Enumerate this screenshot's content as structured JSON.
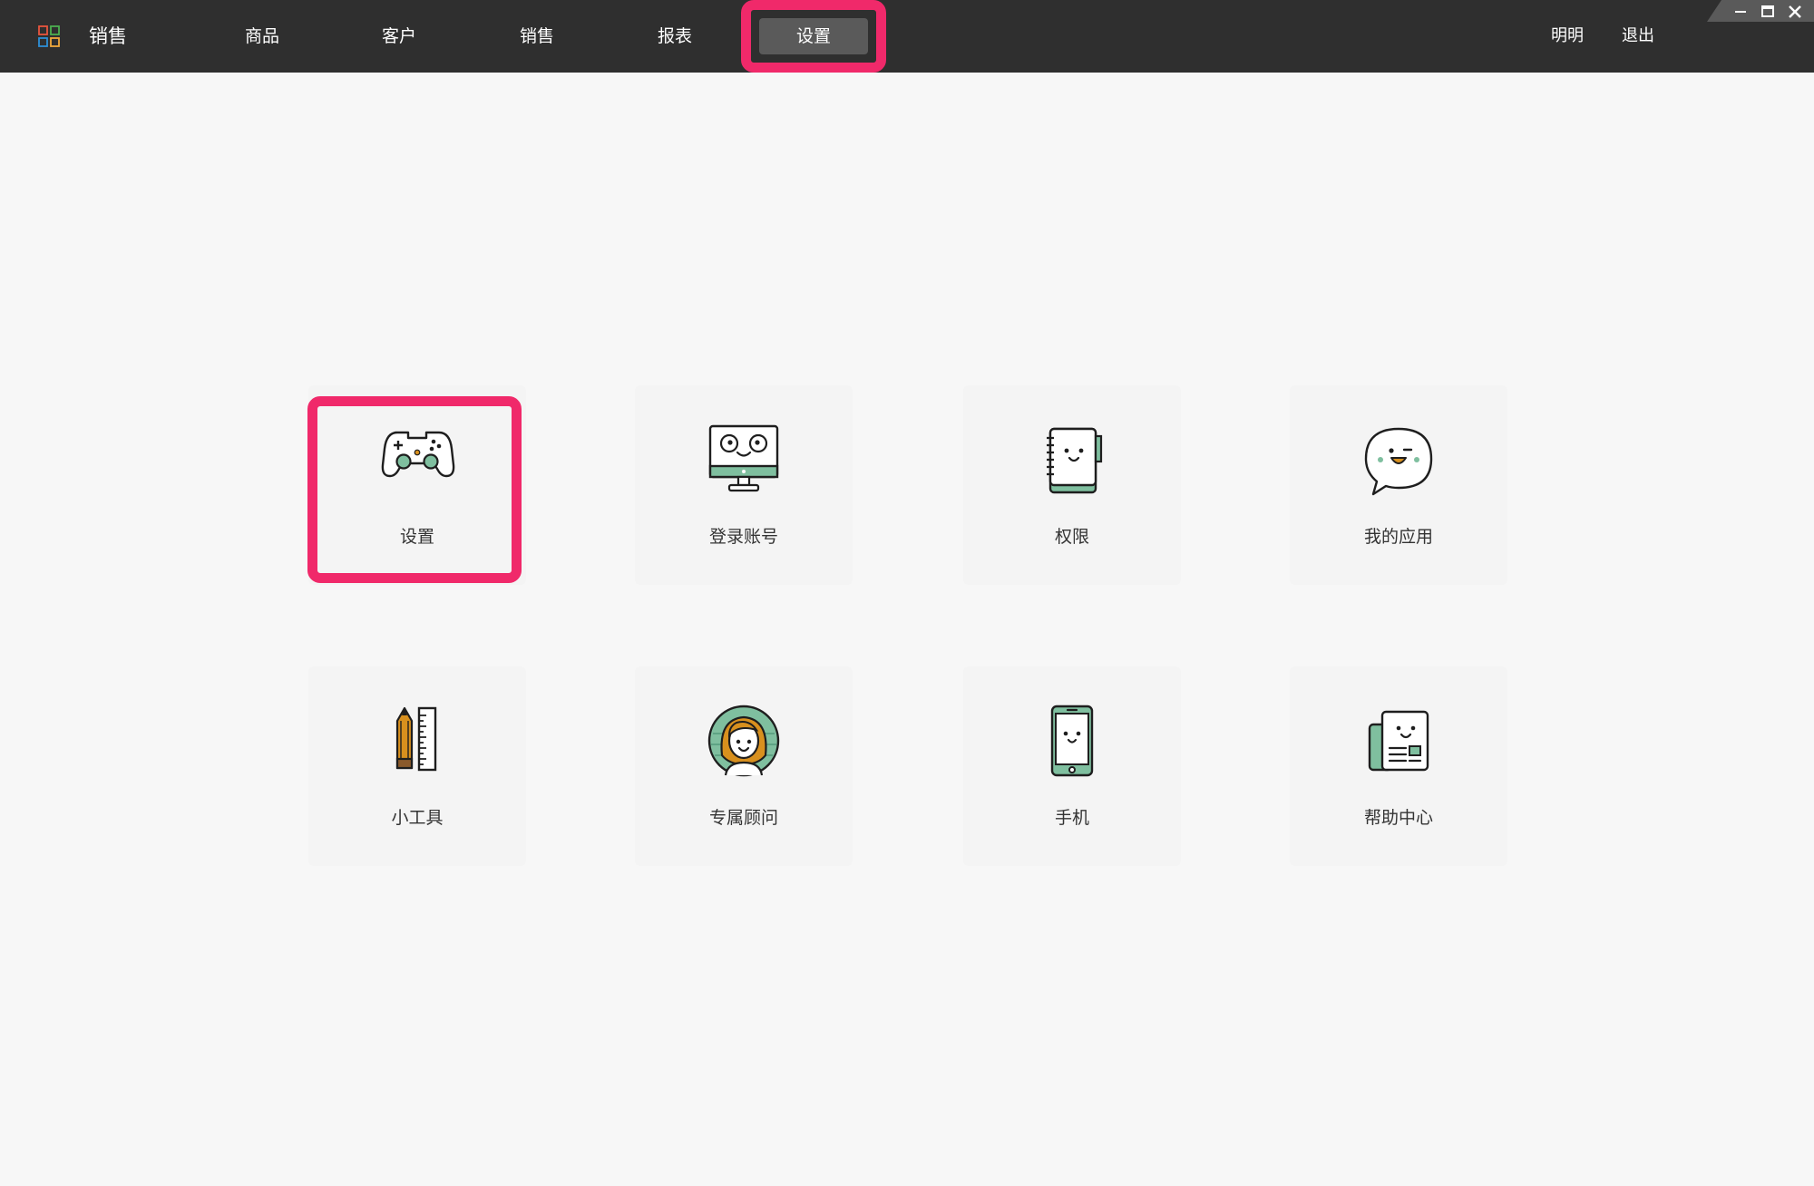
{
  "app": {
    "title": "销售",
    "logo_icon": "grid-apps-icon",
    "logo_colors": [
      "#e8553e",
      "#4caf50",
      "#2d8fd6",
      "#f2a93b"
    ]
  },
  "nav": {
    "items": [
      {
        "label": "商品"
      },
      {
        "label": "客户"
      },
      {
        "label": "销售"
      },
      {
        "label": "报表"
      },
      {
        "label": "设置",
        "active": true
      }
    ]
  },
  "user": {
    "name": "明明",
    "logout_label": "退出"
  },
  "window_controls": [
    "minimize-icon",
    "maximize-icon",
    "close-icon"
  ],
  "tiles": [
    {
      "label": "设置",
      "icon": "gamepad-icon"
    },
    {
      "label": "登录账号",
      "icon": "monitor-icon"
    },
    {
      "label": "权限",
      "icon": "notebook-icon"
    },
    {
      "label": "我的应用",
      "icon": "chat-bubble-icon"
    },
    {
      "label": "小工具",
      "icon": "pencil-ruler-icon"
    },
    {
      "label": "专属顾问",
      "icon": "advisor-avatar-icon"
    },
    {
      "label": "手机",
      "icon": "smartphone-icon"
    },
    {
      "label": "帮助中心",
      "icon": "newspaper-icon"
    }
  ],
  "colors": {
    "topbar": "#2f2f2f",
    "active_tab": "#5a5a5a",
    "highlight": "#f0296a",
    "icon_green": "#7fbf9f",
    "icon_orange": "#d8901e"
  }
}
